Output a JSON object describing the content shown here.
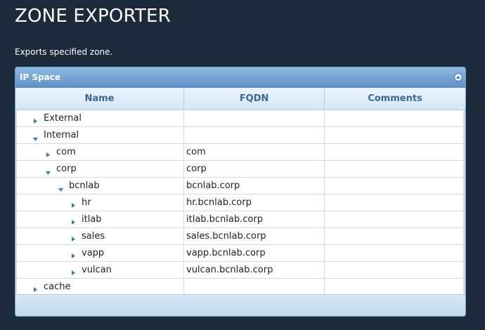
{
  "page": {
    "title": "ZONE EXPORTER",
    "description": "Exports specified zone."
  },
  "panel": {
    "title": "IP Space",
    "collapse_icon": "collapse-up-icon"
  },
  "grid": {
    "columns": [
      "Name",
      "FQDN",
      "Comments"
    ],
    "rows": [
      {
        "name": "External",
        "fqdn": "",
        "comments": "",
        "depth": 0,
        "state": "collapsed"
      },
      {
        "name": "Internal",
        "fqdn": "",
        "comments": "",
        "depth": 0,
        "state": "expanded"
      },
      {
        "name": "com",
        "fqdn": "com",
        "comments": "",
        "depth": 1,
        "state": "collapsed"
      },
      {
        "name": "corp",
        "fqdn": "corp",
        "comments": "",
        "depth": 1,
        "state": "expanded"
      },
      {
        "name": "bcnlab",
        "fqdn": "bcnlab.corp",
        "comments": "",
        "depth": 2,
        "state": "expanded"
      },
      {
        "name": "hr",
        "fqdn": "hr.bcnlab.corp",
        "comments": "",
        "depth": 3,
        "state": "collapsed"
      },
      {
        "name": "itlab",
        "fqdn": "itlab.bcnlab.corp",
        "comments": "",
        "depth": 3,
        "state": "collapsed"
      },
      {
        "name": "sales",
        "fqdn": "sales.bcnlab.corp",
        "comments": "",
        "depth": 3,
        "state": "collapsed"
      },
      {
        "name": "vapp",
        "fqdn": "vapp.bcnlab.corp",
        "comments": "",
        "depth": 3,
        "state": "collapsed"
      },
      {
        "name": "vulcan",
        "fqdn": "vulcan.bcnlab.corp",
        "comments": "",
        "depth": 3,
        "state": "collapsed"
      },
      {
        "name": "cache",
        "fqdn": "",
        "comments": "",
        "depth": 0,
        "state": "collapsed"
      }
    ]
  },
  "colors": {
    "background": "#1c2a3b",
    "panel_header": "#6d9fd2",
    "header_text": "#3e6690",
    "tree_arrow": "#3b78b8"
  }
}
